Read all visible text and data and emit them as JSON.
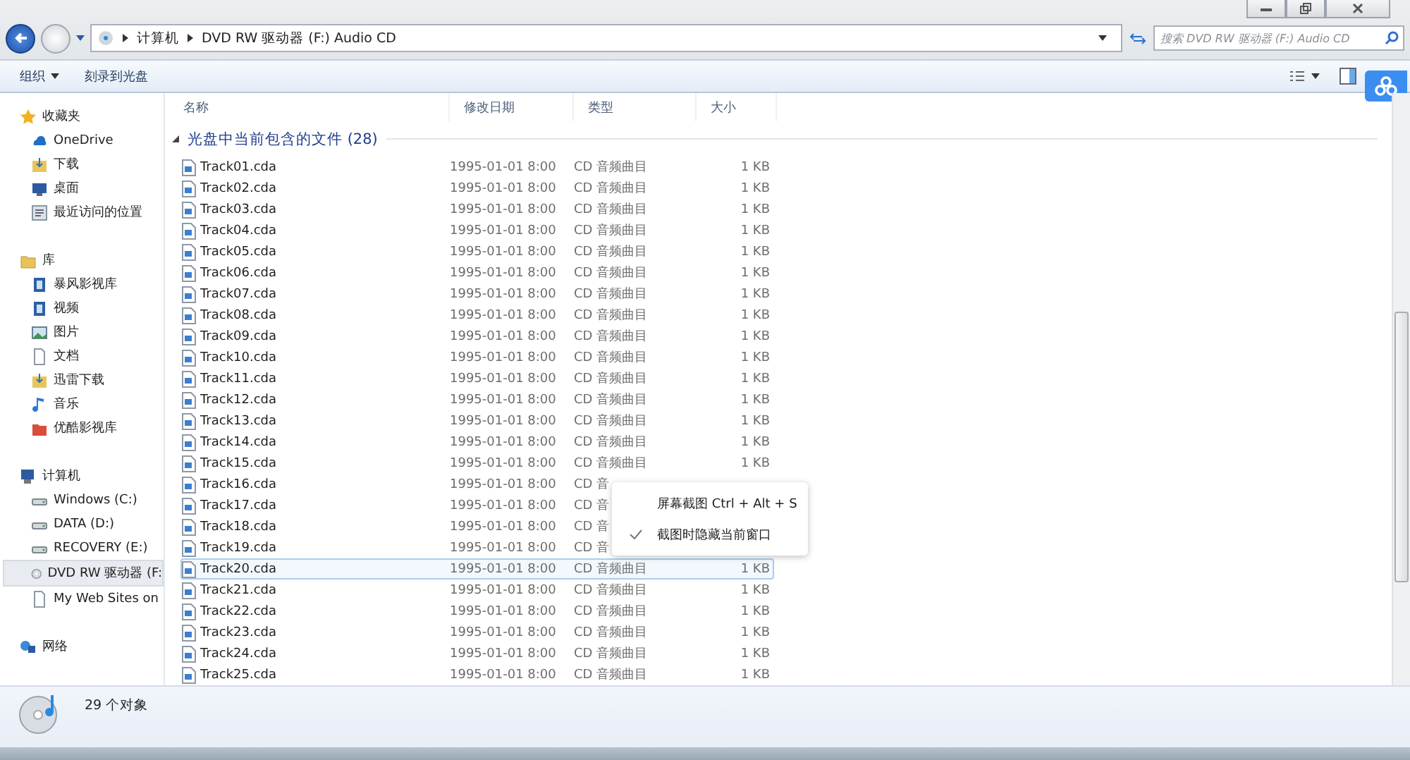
{
  "address_bar": {
    "segments": [
      "计算机",
      "DVD RW 驱动器 (F:) Audio CD"
    ]
  },
  "search": {
    "placeholder": "搜索 DVD RW 驱动器 (F:) Audio CD"
  },
  "toolbar": {
    "items": [
      {
        "label": "组织",
        "dropdown": true
      },
      {
        "label": "刻录到光盘",
        "dropdown": false
      }
    ]
  },
  "sidebar": {
    "groups": [
      {
        "kind": "favorites",
        "label": "收藏夹",
        "items": [
          {
            "label": "OneDrive",
            "kind": "cloud",
            "selected": false
          },
          {
            "label": "下载",
            "kind": "download",
            "selected": false
          },
          {
            "label": "桌面",
            "kind": "desktop",
            "selected": false
          },
          {
            "label": "最近访问的位置",
            "kind": "recent",
            "selected": false
          }
        ]
      },
      {
        "kind": "library",
        "label": "库",
        "items": [
          {
            "label": "暴风影视库",
            "kind": "video",
            "selected": false
          },
          {
            "label": "视频",
            "kind": "video",
            "selected": false
          },
          {
            "label": "图片",
            "kind": "image",
            "selected": false
          },
          {
            "label": "文档",
            "kind": "document",
            "selected": false
          },
          {
            "label": "迅雷下载",
            "kind": "download",
            "selected": false
          },
          {
            "label": "音乐",
            "kind": "music",
            "selected": false
          },
          {
            "label": "优酷影视库",
            "kind": "folder",
            "selected": false
          }
        ]
      },
      {
        "kind": "computer",
        "label": "计算机",
        "items": [
          {
            "label": "Windows (C:)",
            "kind": "drive",
            "selected": false
          },
          {
            "label": "DATA (D:)",
            "kind": "drive",
            "selected": false
          },
          {
            "label": "RECOVERY (E:)",
            "kind": "drive",
            "selected": false
          },
          {
            "label": "DVD RW 驱动器 (F:",
            "kind": "disc",
            "selected": true
          },
          {
            "label": "My Web Sites on",
            "kind": "document",
            "selected": false
          }
        ]
      },
      {
        "kind": "network",
        "label": "网络"
      }
    ]
  },
  "table": {
    "columns": [
      "名称",
      "修改日期",
      "类型",
      "大小"
    ],
    "group_header": "光盘中当前包含的文件 (28)",
    "rows": [
      {
        "name": "Track01.cda",
        "date": "1995-01-01 8:00",
        "type": "CD 音频曲目",
        "size": "1 KB",
        "selected": false
      },
      {
        "name": "Track02.cda",
        "date": "1995-01-01 8:00",
        "type": "CD 音频曲目",
        "size": "1 KB",
        "selected": false
      },
      {
        "name": "Track03.cda",
        "date": "1995-01-01 8:00",
        "type": "CD 音频曲目",
        "size": "1 KB",
        "selected": false
      },
      {
        "name": "Track04.cda",
        "date": "1995-01-01 8:00",
        "type": "CD 音频曲目",
        "size": "1 KB",
        "selected": false
      },
      {
        "name": "Track05.cda",
        "date": "1995-01-01 8:00",
        "type": "CD 音频曲目",
        "size": "1 KB",
        "selected": false
      },
      {
        "name": "Track06.cda",
        "date": "1995-01-01 8:00",
        "type": "CD 音频曲目",
        "size": "1 KB",
        "selected": false
      },
      {
        "name": "Track07.cda",
        "date": "1995-01-01 8:00",
        "type": "CD 音频曲目",
        "size": "1 KB",
        "selected": false
      },
      {
        "name": "Track08.cda",
        "date": "1995-01-01 8:00",
        "type": "CD 音频曲目",
        "size": "1 KB",
        "selected": false
      },
      {
        "name": "Track09.cda",
        "date": "1995-01-01 8:00",
        "type": "CD 音频曲目",
        "size": "1 KB",
        "selected": false
      },
      {
        "name": "Track10.cda",
        "date": "1995-01-01 8:00",
        "type": "CD 音频曲目",
        "size": "1 KB",
        "selected": false
      },
      {
        "name": "Track11.cda",
        "date": "1995-01-01 8:00",
        "type": "CD 音频曲目",
        "size": "1 KB",
        "selected": false
      },
      {
        "name": "Track12.cda",
        "date": "1995-01-01 8:00",
        "type": "CD 音频曲目",
        "size": "1 KB",
        "selected": false
      },
      {
        "name": "Track13.cda",
        "date": "1995-01-01 8:00",
        "type": "CD 音频曲目",
        "size": "1 KB",
        "selected": false
      },
      {
        "name": "Track14.cda",
        "date": "1995-01-01 8:00",
        "type": "CD 音频曲目",
        "size": "1 KB",
        "selected": false
      },
      {
        "name": "Track15.cda",
        "date": "1995-01-01 8:00",
        "type": "CD 音频曲目",
        "size": "1 KB",
        "selected": false
      },
      {
        "name": "Track16.cda",
        "date": "1995-01-01 8:00",
        "type": "CD 音",
        "selected": false
      },
      {
        "name": "Track17.cda",
        "date": "1995-01-01 8:00",
        "type": "CD 音",
        "selected": false
      },
      {
        "name": "Track18.cda",
        "date": "1995-01-01 8:00",
        "type": "CD 音",
        "selected": false
      },
      {
        "name": "Track19.cda",
        "date": "1995-01-01 8:00",
        "type": "CD 音",
        "selected": false
      },
      {
        "name": "Track20.cda",
        "date": "1995-01-01 8:00",
        "type": "CD 音频曲目",
        "size": "1 KB",
        "selected": true
      },
      {
        "name": "Track21.cda",
        "date": "1995-01-01 8:00",
        "type": "CD 音频曲目",
        "size": "1 KB",
        "selected": false
      },
      {
        "name": "Track22.cda",
        "date": "1995-01-01 8:00",
        "type": "CD 音频曲目",
        "size": "1 KB",
        "selected": false
      },
      {
        "name": "Track23.cda",
        "date": "1995-01-01 8:00",
        "type": "CD 音频曲目",
        "size": "1 KB",
        "selected": false
      },
      {
        "name": "Track24.cda",
        "date": "1995-01-01 8:00",
        "type": "CD 音频曲目",
        "size": "1 KB",
        "selected": false
      },
      {
        "name": "Track25.cda",
        "date": "1995-01-01 8:00",
        "type": "CD 音频曲目",
        "size": "1 KB",
        "selected": false
      }
    ]
  },
  "context_menu": {
    "items": [
      {
        "label": "屏幕截图 Ctrl + Alt + S",
        "checked": false
      },
      {
        "label": "截图时隐藏当前窗口",
        "checked": true
      }
    ]
  },
  "status_bar": {
    "count": "29 个对象"
  }
}
